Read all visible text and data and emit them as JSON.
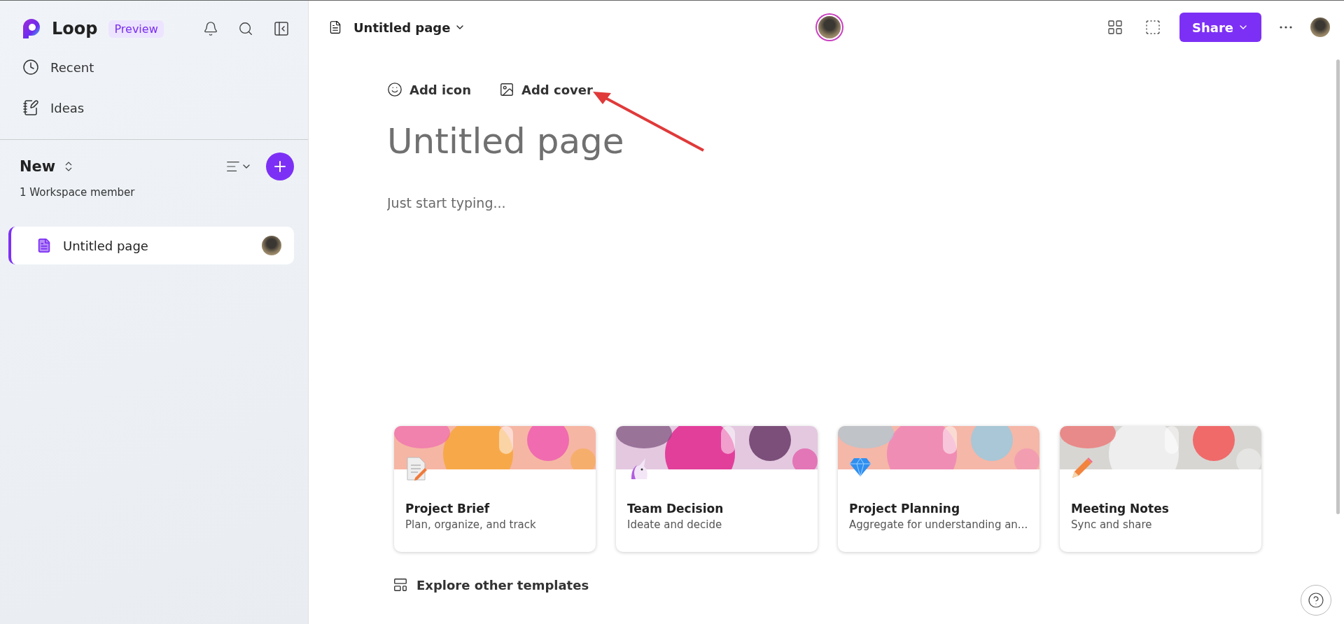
{
  "sidebar": {
    "app_name": "Loop",
    "badge": "Preview",
    "nav": [
      {
        "kind": "recent",
        "label": "Recent"
      },
      {
        "kind": "ideas",
        "label": "Ideas"
      }
    ],
    "workspace": {
      "name": "New",
      "members": "1 Workspace member"
    },
    "pages": [
      {
        "label": "Untitled page",
        "selected": true
      }
    ]
  },
  "topbar": {
    "page_title": "Untitled page",
    "share": "Share"
  },
  "page": {
    "actions": [
      {
        "kind": "icon",
        "label": "Add icon"
      },
      {
        "kind": "cover",
        "label": "Add cover"
      }
    ],
    "title_placeholder": "Untitled page",
    "body_placeholder": "Just start typing..."
  },
  "templates": [
    {
      "kind": "document",
      "title": "Project Brief",
      "subtitle": "Plan, organize, and track"
    },
    {
      "kind": "unicorn",
      "title": "Team Decision",
      "subtitle": "Ideate and decide"
    },
    {
      "kind": "diamond",
      "title": "Project Planning",
      "subtitle": "Aggregate for understanding an..."
    },
    {
      "kind": "pencil",
      "title": "Meeting Notes",
      "subtitle": "Sync and share"
    }
  ],
  "explore": "Explore other templates"
}
